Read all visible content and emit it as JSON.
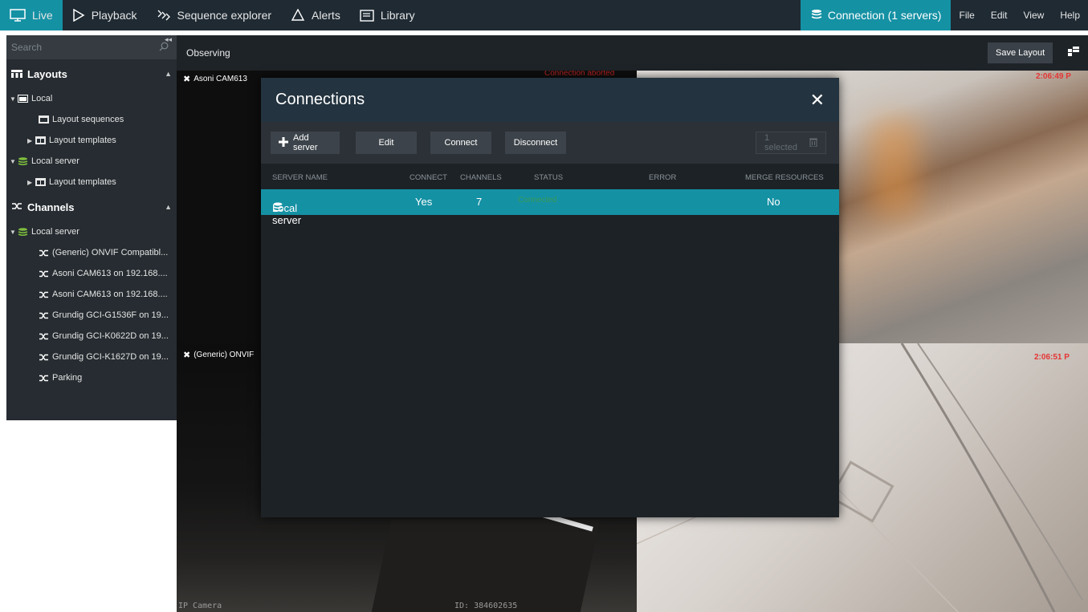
{
  "nav": {
    "tabs": [
      {
        "label": "Live",
        "icon": "monitor-icon"
      },
      {
        "label": "Playback",
        "icon": "play-icon"
      },
      {
        "label": "Sequence explorer",
        "icon": "sequence-icon"
      },
      {
        "label": "Alerts",
        "icon": "bell-icon"
      },
      {
        "label": "Library",
        "icon": "library-icon"
      }
    ],
    "connection_label": "Connection (1 servers)",
    "menu": [
      "File",
      "Edit",
      "View",
      "Help"
    ]
  },
  "sidebar": {
    "search_placeholder": "Search",
    "layouts_header": "Layouts",
    "layouts_items": [
      {
        "label": "Local"
      },
      {
        "label": "Layout sequences"
      },
      {
        "label": "Layout templates"
      },
      {
        "label": "Local server"
      },
      {
        "label": "Layout templates"
      }
    ],
    "channels_header": "Channels",
    "channels_server": "Local server",
    "channels_items": [
      "(Generic) ONVIF Compatibl...",
      "Asoni CAM613 on 192.168....",
      "Asoni CAM613 on 192.168....",
      "Grundig GCI-G1536F on 19...",
      "Grundig GCI-K0622D on 19...",
      "Grundig GCI-K1627D on 19...",
      "Parking"
    ]
  },
  "main": {
    "observing_label": "Observing",
    "save_layout_label": "Save Layout",
    "tile_labels": {
      "tl": "Asoni CAM613",
      "bl": "(Generic) ONVIF"
    },
    "overlay_text": {
      "connection_aborted": "Connection aborted",
      "ip_camera": "IP Camera",
      "id_code": "ID: 384602635"
    },
    "timestamps": [
      "2:06:49 P",
      "2:06:51 P"
    ]
  },
  "modal": {
    "title": "Connections",
    "buttons": {
      "add": "Add server",
      "edit": "Edit",
      "connect": "Connect",
      "disconnect": "Disconnect",
      "selected": "1 selected"
    },
    "columns": [
      "SERVER NAME",
      "CONNECT",
      "CHANNELS",
      "STATUS",
      "ERROR",
      "MERGE RESOURCES"
    ],
    "rows": [
      {
        "server_name": "Local server",
        "connect": "Yes",
        "channels": "7",
        "status": "Connected",
        "error": "",
        "merge": "No"
      }
    ]
  },
  "colors": {
    "accent": "#1591a4",
    "topbar": "#1f2a33",
    "status_connected": "#3a9a55",
    "timestamp_red": "#e53535"
  }
}
